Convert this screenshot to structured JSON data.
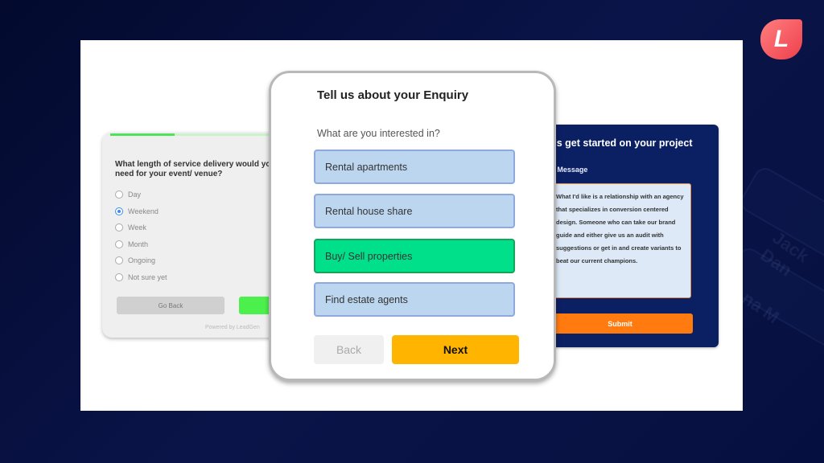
{
  "brand": {
    "logo_letter": "L",
    "accent": "#ee3f4c"
  },
  "background_decor": {
    "names": [
      "Jack Dan",
      "na M"
    ]
  },
  "left_form": {
    "progress_fraction": 0.38,
    "question": "What length of service delivery would you need for your event/ venue?",
    "options": [
      {
        "label": "Day",
        "checked": false
      },
      {
        "label": "Weekend",
        "checked": true
      },
      {
        "label": "Week",
        "checked": false
      },
      {
        "label": "Month",
        "checked": false
      },
      {
        "label": "Ongoing",
        "checked": false
      },
      {
        "label": "Not sure yet",
        "checked": false
      }
    ],
    "go_back_label": "Go Back",
    "powered_by": "Powered by  LeadGen"
  },
  "center_form": {
    "title": "Tell us about your Enquiry",
    "subtitle": "What are you interested in?",
    "options": [
      {
        "label": "Rental apartments",
        "selected": false
      },
      {
        "label": "Rental house share",
        "selected": false
      },
      {
        "label": "Buy/ Sell properties",
        "selected": true
      },
      {
        "label": "Find estate agents",
        "selected": false
      }
    ],
    "back_label": "Back",
    "next_label": "Next"
  },
  "right_form": {
    "title": "Let's get started on your project",
    "message_label": "Your Message",
    "message": "What I'd like is a relationship with an agency that specializes in conversion centered design. Someone who can take our brand guide and either give us an audit with suggestions or get in and create variants to beat our current champions.",
    "submit_label": "Submit"
  }
}
